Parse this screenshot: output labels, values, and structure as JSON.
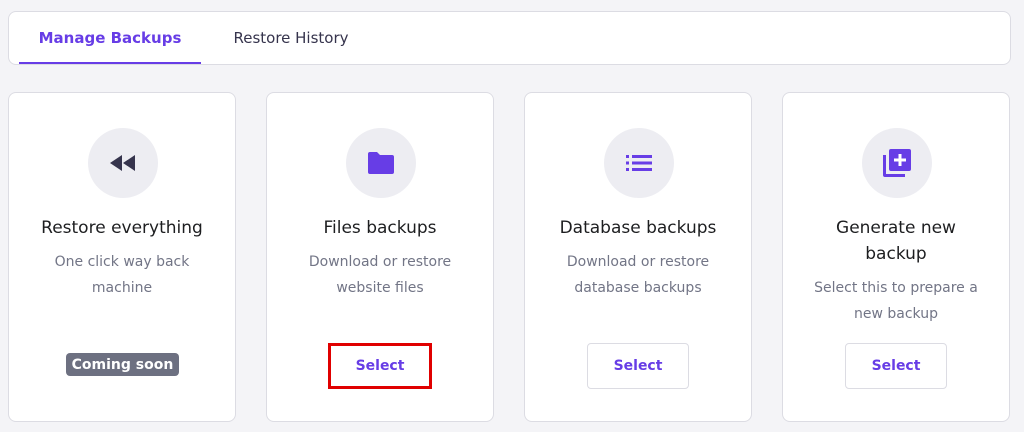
{
  "tabs": [
    {
      "label": "Manage Backups",
      "active": true
    },
    {
      "label": "Restore History",
      "active": false
    }
  ],
  "cards": [
    {
      "icon": "rewind-icon",
      "title": "Restore everything",
      "description": "One click way back machine",
      "badge": "Coming soon"
    },
    {
      "icon": "folder-icon",
      "title": "Files backups",
      "description": "Download or restore website files",
      "button": "Select"
    },
    {
      "icon": "list-icon",
      "title": "Database backups",
      "description": "Download or restore database backups",
      "button": "Select"
    },
    {
      "icon": "add-layers-icon",
      "title": "Generate new backup",
      "description": "Select this to prepare a new backup",
      "button": "Select"
    }
  ],
  "colors": {
    "accent": "#673de6",
    "badge": "#6d7081",
    "highlight_border": "#e00000",
    "background": "#f4f4f7"
  }
}
